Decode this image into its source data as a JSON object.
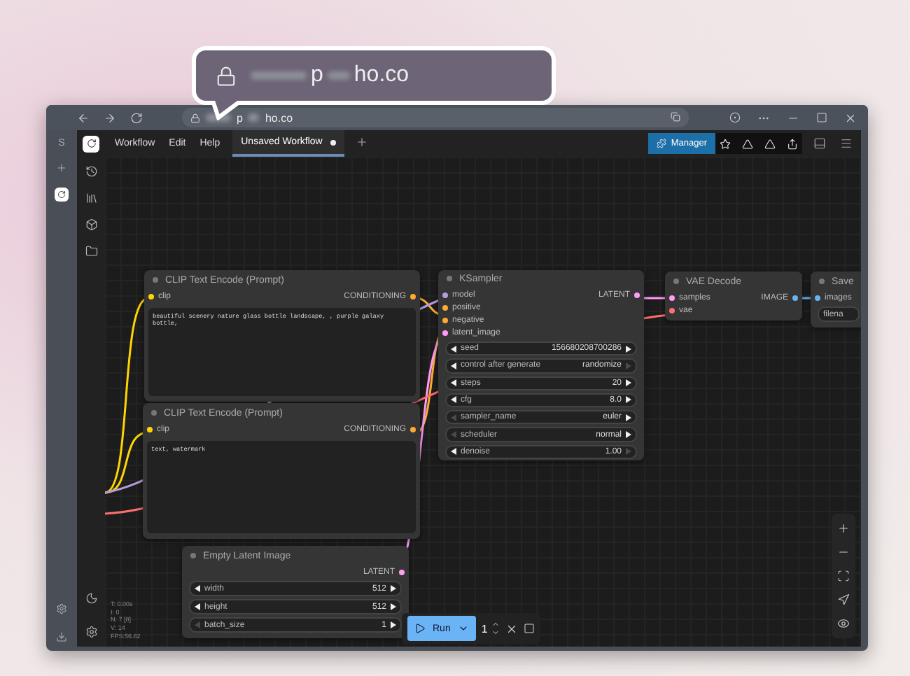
{
  "callout": {
    "url_parts": [
      {
        "kind": "blurred"
      },
      {
        "kind": "text",
        "text": "p"
      },
      {
        "kind": "blurred"
      },
      {
        "kind": "text",
        "text": "ho.co"
      }
    ]
  },
  "browser": {
    "url_parts": [
      {
        "kind": "blurred"
      },
      {
        "kind": "text",
        "text": "p"
      },
      {
        "kind": "blurred"
      },
      {
        "kind": "text",
        "text": "ho.co"
      }
    ],
    "sidebar_label": "S"
  },
  "menubar": {
    "menus": [
      "Workflow",
      "Edit",
      "Help"
    ],
    "tabs": [
      {
        "label": "Unsaved Workflow",
        "selected": true,
        "modified": true
      }
    ],
    "manager": "Manager"
  },
  "nodes": [
    {
      "title": "CLIP Text Encode (Prompt)",
      "inputs": [
        {
          "name": "clip",
          "color": "#ffd500"
        }
      ],
      "outputs": [
        {
          "name": "CONDITIONING",
          "color": "#ffa931"
        }
      ],
      "text": "beautiful scenery nature glass bottle landscape, , purple galaxy bottle,"
    },
    {
      "title": "CLIP Text Encode (Prompt)",
      "inputs": [
        {
          "name": "clip",
          "color": "#ffd500"
        }
      ],
      "outputs": [
        {
          "name": "CONDITIONING",
          "color": "#ffa931"
        }
      ],
      "text": "text, watermark"
    },
    {
      "title": "KSampler",
      "inputs": [
        {
          "name": "model",
          "color": "#b39ddb"
        },
        {
          "name": "positive",
          "color": "#ffa931"
        },
        {
          "name": "negative",
          "color": "#ffa931"
        },
        {
          "name": "latent_image",
          "color": "#ff9cf9"
        }
      ],
      "outputs": [
        {
          "name": "LATENT",
          "color": "#ff9cf9"
        }
      ],
      "widgets": [
        {
          "name": "seed",
          "value": "156680208700286",
          "left_enabled": true,
          "right_enabled": true
        },
        {
          "name": "control after generate",
          "value": "randomize",
          "left_enabled": true,
          "right_enabled": false
        },
        {
          "name": "steps",
          "value": "20",
          "left_enabled": true,
          "right_enabled": true
        },
        {
          "name": "cfg",
          "value": "8.0",
          "left_enabled": true,
          "right_enabled": true
        },
        {
          "name": "sampler_name",
          "value": "euler",
          "left_enabled": false,
          "right_enabled": true
        },
        {
          "name": "scheduler",
          "value": "normal",
          "left_enabled": false,
          "right_enabled": true
        },
        {
          "name": "denoise",
          "value": "1.00",
          "left_enabled": true,
          "right_enabled": false
        }
      ]
    },
    {
      "title": "VAE Decode",
      "inputs": [
        {
          "name": "samples",
          "color": "#ff9cf9"
        },
        {
          "name": "vae",
          "color": "#ff6e6e"
        }
      ],
      "outputs": [
        {
          "name": "IMAGE",
          "color": "#64b5f6"
        }
      ]
    },
    {
      "title": "Save",
      "inputs": [
        {
          "name": "images",
          "color": "#64b5f6"
        }
      ],
      "widgets": [
        {
          "name": "filena"
        }
      ]
    },
    {
      "title": "Empty Latent Image",
      "outputs": [
        {
          "name": "LATENT",
          "color": "#ff9cf9"
        }
      ],
      "widgets": [
        {
          "name": "width",
          "value": "512",
          "left_enabled": true,
          "right_enabled": true
        },
        {
          "name": "height",
          "value": "512",
          "left_enabled": true,
          "right_enabled": true
        },
        {
          "name": "batch_size",
          "value": "1",
          "left_enabled": false,
          "right_enabled": true
        }
      ]
    }
  ],
  "stats": [
    "T: 0.00s",
    "I: 0",
    "N: 7 [8]",
    "V: 14",
    "FPS:56.82"
  ],
  "run_bar": {
    "run": "Run",
    "count": "1"
  }
}
